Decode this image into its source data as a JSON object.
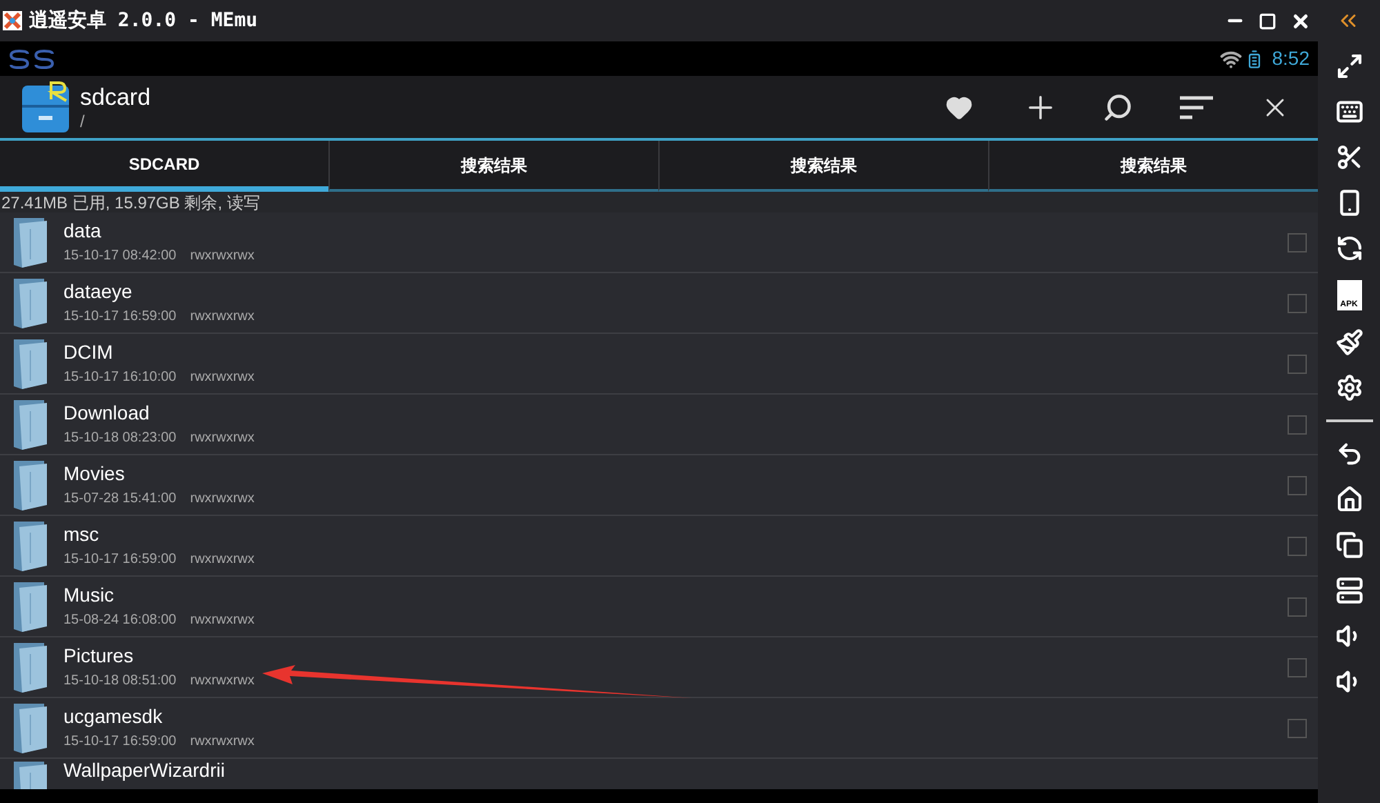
{
  "window": {
    "title": "逍遥安卓 2.0.0 - MEmu"
  },
  "status_bar": {
    "time": "8:52"
  },
  "action_bar": {
    "title": "sdcard",
    "path": "/"
  },
  "tabs": [
    {
      "label": "SDCARD",
      "selected": true
    },
    {
      "label": "搜索结果",
      "selected": false
    },
    {
      "label": "搜索结果",
      "selected": false
    },
    {
      "label": "搜索结果",
      "selected": false
    }
  ],
  "storage_info": "27.41MB 已用, 15.97GB 剩余, 读写",
  "files": [
    {
      "name": "data",
      "date": "15-10-17 08:42:00",
      "permissions": "rwxrwxrwx",
      "checked": false
    },
    {
      "name": "dataeye",
      "date": "15-10-17 16:59:00",
      "permissions": "rwxrwxrwx",
      "checked": false
    },
    {
      "name": "DCIM",
      "date": "15-10-17 16:10:00",
      "permissions": "rwxrwxrwx",
      "checked": false
    },
    {
      "name": "Download",
      "date": "15-10-18 08:23:00",
      "permissions": "rwxrwxrwx",
      "checked": false
    },
    {
      "name": "Movies",
      "date": "15-07-28 15:41:00",
      "permissions": "rwxrwxrwx",
      "checked": false
    },
    {
      "name": "msc",
      "date": "15-10-17 16:59:00",
      "permissions": "rwxrwxrwx",
      "checked": false
    },
    {
      "name": "Music",
      "date": "15-08-24 16:08:00",
      "permissions": "rwxrwxrwx",
      "checked": false
    },
    {
      "name": "Pictures",
      "date": "15-10-18 08:51:00",
      "permissions": "rwxrwxrwx",
      "checked": false
    },
    {
      "name": "ucgamesdk",
      "date": "15-10-17 16:59:00",
      "permissions": "rwxrwxrwx",
      "checked": false
    },
    {
      "name": "WallpaperWizardrii"
    }
  ],
  "sidebar": {
    "apk_label": "APK"
  }
}
